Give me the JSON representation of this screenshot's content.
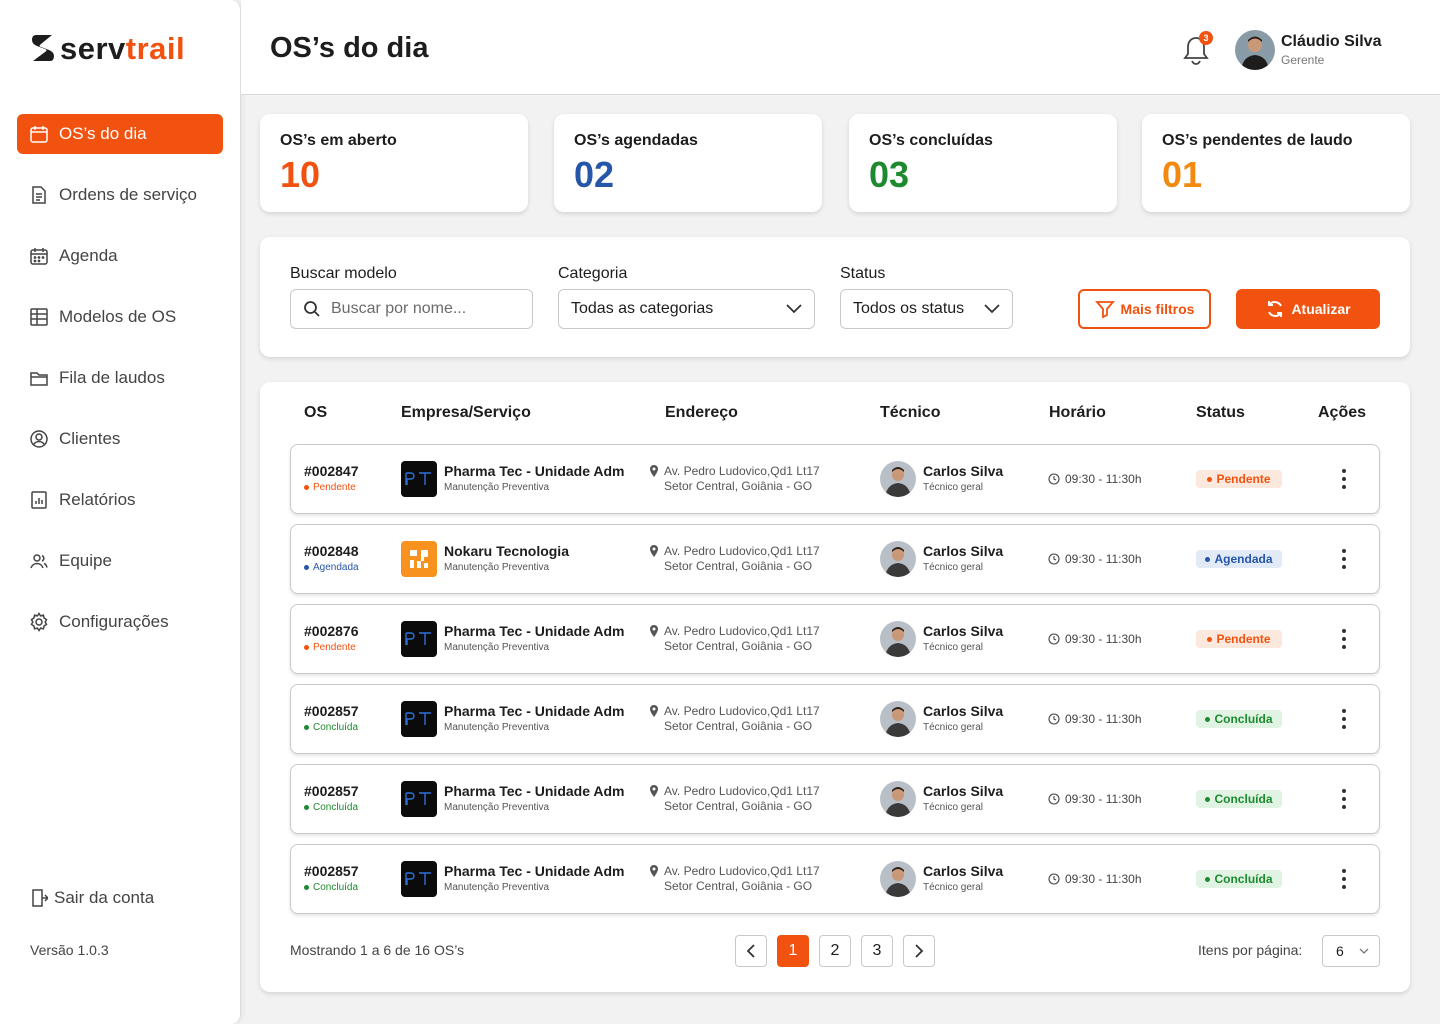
{
  "brand": {
    "part1": "serv",
    "part2": "trail"
  },
  "sidebar": {
    "items": [
      {
        "label": "OS’s do dia",
        "icon": "calendar-icon",
        "active": true
      },
      {
        "label": "Ordens de serviço",
        "icon": "document-icon"
      },
      {
        "label": "Agenda",
        "icon": "calendar-grid-icon"
      },
      {
        "label": "Modelos de OS",
        "icon": "template-icon"
      },
      {
        "label": "Fila de laudos",
        "icon": "folder-icon"
      },
      {
        "label": "Clientes",
        "icon": "user-circle-icon"
      },
      {
        "label": "Relatórios",
        "icon": "report-icon"
      },
      {
        "label": "Equipe",
        "icon": "team-icon"
      },
      {
        "label": "Configurações",
        "icon": "gear-icon"
      }
    ],
    "logout": "Sair da conta",
    "version": "Versão 1.0.3"
  },
  "header": {
    "title": "OS’s do dia",
    "notifications": "3",
    "user_name": "Cláudio Silva",
    "user_role": "Gerente"
  },
  "stats": [
    {
      "label": "OS’s em aberto",
      "value": "10",
      "color": "#f2520f"
    },
    {
      "label": "OS’s agendadas",
      "value": "02",
      "color": "#2656a8"
    },
    {
      "label": "OS’s concluídas",
      "value": "03",
      "color": "#1d8a2f"
    },
    {
      "label": "OS’s pendentes de laudo",
      "value": "01",
      "color": "#f28a0f"
    }
  ],
  "filters": {
    "search_label": "Buscar modelo",
    "search_placeholder": "Buscar por nome...",
    "category_label": "Categoria",
    "category_value": "Todas as categorias",
    "status_label": "Status",
    "status_value": "Todos os status",
    "more_filters": "Mais filtros",
    "refresh": "Atualizar"
  },
  "table": {
    "headers": {
      "os": "OS",
      "company": "Empresa/Serviço",
      "address": "Endereço",
      "tech": "Técnico",
      "time": "Horário",
      "status": "Status",
      "actions": "Ações"
    },
    "rows": [
      {
        "os": "#002847",
        "status": "Pendente",
        "status_key": "pend",
        "company": "Pharma Tec - Unidade Adm",
        "service": "Manutenção Preventiva",
        "logo": "PT",
        "addr1": "Av. Pedro Ludovico,Qd1 Lt17",
        "addr2": "Setor Central, Goiânia - GO",
        "tech": "Carlos Silva",
        "tech_role": "Técnico geral",
        "time": "09:30 - 11:30h"
      },
      {
        "os": "#002848",
        "status": "Agendada",
        "status_key": "agen",
        "company": "Nokaru Tecnologia",
        "service": "Manutenção Preventiva",
        "logo": "NK",
        "addr1": "Av. Pedro Ludovico,Qd1 Lt17",
        "addr2": "Setor Central, Goiânia - GO",
        "tech": "Carlos Silva",
        "tech_role": "Técnico geral",
        "time": "09:30 - 11:30h"
      },
      {
        "os": "#002876",
        "status": "Pendente",
        "status_key": "pend",
        "company": "Pharma Tec - Unidade Adm",
        "service": "Manutenção Preventiva",
        "logo": "PT",
        "addr1": "Av. Pedro Ludovico,Qd1 Lt17",
        "addr2": "Setor Central, Goiânia - GO",
        "tech": "Carlos Silva",
        "tech_role": "Técnico geral",
        "time": "09:30 - 11:30h"
      },
      {
        "os": "#002857",
        "status": "Concluída",
        "status_key": "conc",
        "company": "Pharma Tec - Unidade Adm",
        "service": "Manutenção Preventiva",
        "logo": "PT",
        "addr1": "Av. Pedro Ludovico,Qd1 Lt17",
        "addr2": "Setor Central, Goiânia - GO",
        "tech": "Carlos Silva",
        "tech_role": "Técnico geral",
        "time": "09:30 - 11:30h"
      },
      {
        "os": "#002857",
        "status": "Concluída",
        "status_key": "conc",
        "company": "Pharma Tec - Unidade Adm",
        "service": "Manutenção Preventiva",
        "logo": "PT",
        "addr1": "Av. Pedro Ludovico,Qd1 Lt17",
        "addr2": "Setor Central, Goiânia - GO",
        "tech": "Carlos Silva",
        "tech_role": "Técnico geral",
        "time": "09:30 - 11:30h"
      },
      {
        "os": "#002857",
        "status": "Concluída",
        "status_key": "conc",
        "company": "Pharma Tec - Unidade Adm",
        "service": "Manutenção Preventiva",
        "logo": "PT",
        "addr1": "Av. Pedro Ludovico,Qd1 Lt17",
        "addr2": "Setor Central, Goiânia - GO",
        "tech": "Carlos Silva",
        "tech_role": "Técnico geral",
        "time": "09:30 - 11:30h"
      }
    ]
  },
  "pagination": {
    "showing": "Mostrando 1 a 6 de 16 OS’s",
    "pages": [
      "1",
      "2",
      "3"
    ],
    "current": "1",
    "per_page_label": "Itens por página:",
    "per_page_value": "6"
  },
  "colors": {
    "accent": "#f2520f",
    "blue": "#2656a8",
    "green": "#1d8a2f",
    "amber": "#f28a0f"
  }
}
